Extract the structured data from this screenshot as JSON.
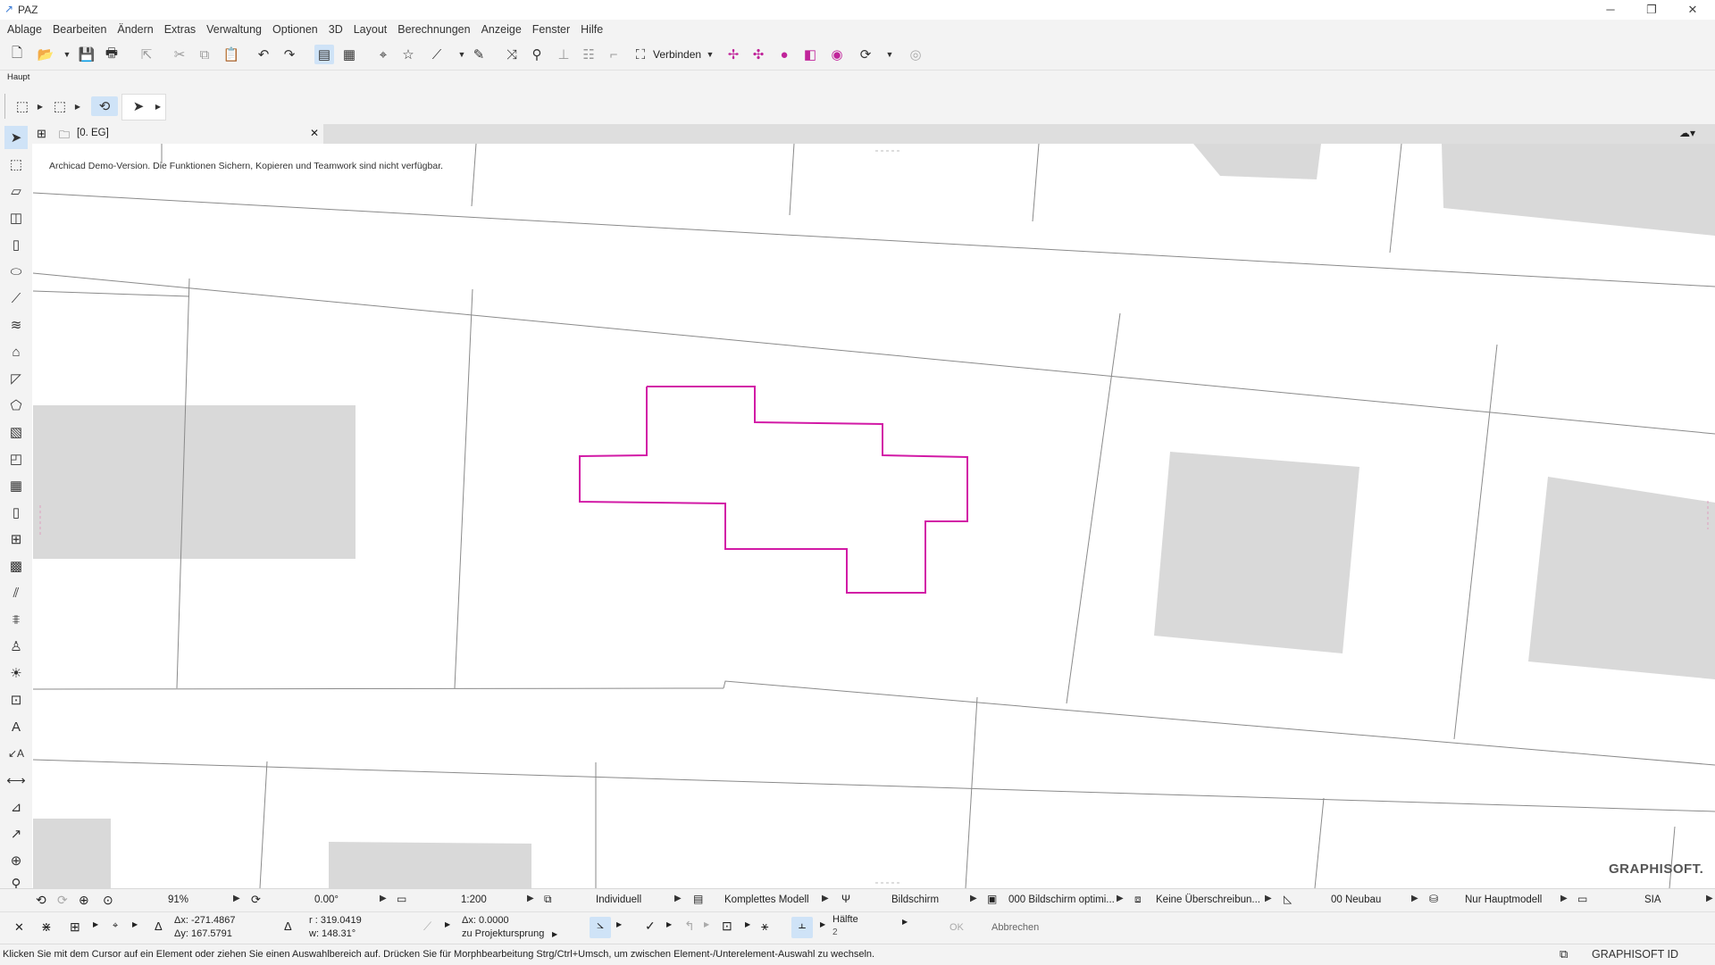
{
  "window": {
    "title": "PAZ"
  },
  "menu": [
    "Ablage",
    "Bearbeiten",
    "Ändern",
    "Extras",
    "Verwaltung",
    "Optionen",
    "3D",
    "Layout",
    "Berechnungen",
    "Anzeige",
    "Fenster",
    "Hilfe"
  ],
  "toolbar": {
    "connect_label": "Verbinden"
  },
  "panel": {
    "label": "Haupt"
  },
  "tab": {
    "label": "[0. EG]"
  },
  "canvas": {
    "notice": "Archicad Demo-Version. Die Funktionen Sichern, Kopieren und Teamwork sind nicht verfügbar.",
    "brand": "GRAPHISOFT.",
    "highlight_color": "#d21aa6",
    "building_fill": "#d9d9d9"
  },
  "options": {
    "zoom": "91%",
    "angle": "0.00°",
    "scale": "1:200",
    "layer_combo": "Individuell",
    "model_view": "Komplettes Modell",
    "pen_set": "Bildschirm",
    "graphic_override": "000 Bildschirm optimi...",
    "dimension": "Keine Überschreibun...",
    "renovation": "00 Neubau",
    "structure": "Nur Hauptmodell",
    "standard": "SIA"
  },
  "coords": {
    "dx": "Δx: -271.4867",
    "dy": "Δy: 167.5791",
    "r": "r : 319.0419",
    "w": "w: 148.31°",
    "x": "Δx: 0.0000",
    "ref": "zu Projektursprung",
    "half_label": "Hälfte",
    "half_value": "2",
    "ok": "OK",
    "cancel": "Abbrechen"
  },
  "hint": "Klicken Sie mit dem Cursor auf ein Element oder ziehen Sie einen Auswahlbereich auf. Drücken Sie für Morphbearbeitung Strg/Ctrl+Umsch, um zwischen Element-/Unterelement-Auswahl zu wechseln.",
  "graphisoft_id": "GRAPHISOFT ID"
}
